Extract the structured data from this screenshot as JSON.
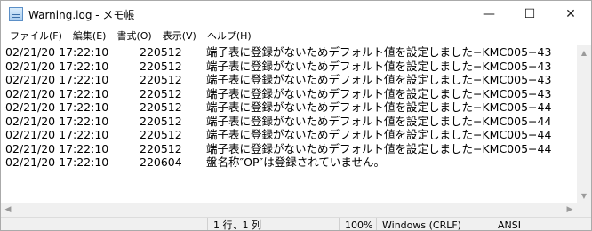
{
  "window": {
    "title": "Warning.log - メモ帳",
    "minimize_glyph": "—",
    "maximize_glyph": "☐",
    "close_glyph": "✕"
  },
  "menu": {
    "items": [
      "ファイル(F)",
      "編集(E)",
      "書式(O)",
      "表示(V)",
      "ヘルプ(H)"
    ]
  },
  "editor": {
    "lines": [
      {
        "date": "02/21/20 17:22:10",
        "code": "220512",
        "message": "端子表に登録がないためデフォルト値を設定しました−KMC005−43"
      },
      {
        "date": "02/21/20 17:22:10",
        "code": "220512",
        "message": "端子表に登録がないためデフォルト値を設定しました−KMC005−43"
      },
      {
        "date": "02/21/20 17:22:10",
        "code": "220512",
        "message": "端子表に登録がないためデフォルト値を設定しました−KMC005−43"
      },
      {
        "date": "02/21/20 17:22:10",
        "code": "220512",
        "message": "端子表に登録がないためデフォルト値を設定しました−KMC005−43"
      },
      {
        "date": "02/21/20 17:22:10",
        "code": "220512",
        "message": "端子表に登録がないためデフォルト値を設定しました−KMC005−44"
      },
      {
        "date": "02/21/20 17:22:10",
        "code": "220512",
        "message": "端子表に登録がないためデフォルト値を設定しました−KMC005−44"
      },
      {
        "date": "02/21/20 17:22:10",
        "code": "220512",
        "message": "端子表に登録がないためデフォルト値を設定しました−KMC005−44"
      },
      {
        "date": "02/21/20 17:22:10",
        "code": "220512",
        "message": "端子表に登録がないためデフォルト値を設定しました−KMC005−44"
      },
      {
        "date": "02/21/20 17:22:10",
        "code": "220604",
        "message": "盤名称″OP″は登録されていません。"
      }
    ]
  },
  "statusbar": {
    "position": "1 行、1 列",
    "zoom": "100%",
    "line_ending": "Windows (CRLF)",
    "encoding": "ANSI"
  },
  "colors": {
    "titlebar_bg": "#ffffff",
    "chrome_bg": "#f0f0f0",
    "text": "#000000"
  }
}
